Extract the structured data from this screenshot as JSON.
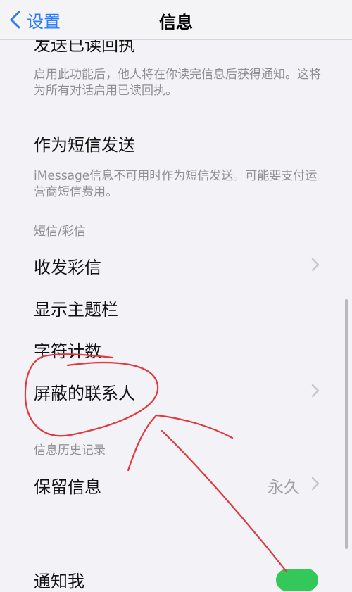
{
  "nav": {
    "back_label": "设置",
    "title": "信息"
  },
  "rows": {
    "read_receipts": "发送已读回执",
    "read_receipts_note": "启用此功能后，他人将在你读完信息后获得通知。这将为所有对话启用已读回执。",
    "send_as_sms": "作为短信发送",
    "send_as_sms_note": "iMessage信息不可用时作为短信发送。可能要支付运营商短信费用。",
    "sms_mms_header": "短信/彩信",
    "mms": "收发彩信",
    "subject_field": "显示主题栏",
    "char_count": "字符计数",
    "blocked": "屏蔽的联系人",
    "history_header": "信息历史记录",
    "keep_messages": "保留信息",
    "keep_messages_value": "永久",
    "notify_me": "通知我"
  },
  "toggle_on": true,
  "colors": {
    "accent": "#2b7cf6",
    "annotation": "#e0393e",
    "toggle": "#34c759"
  }
}
